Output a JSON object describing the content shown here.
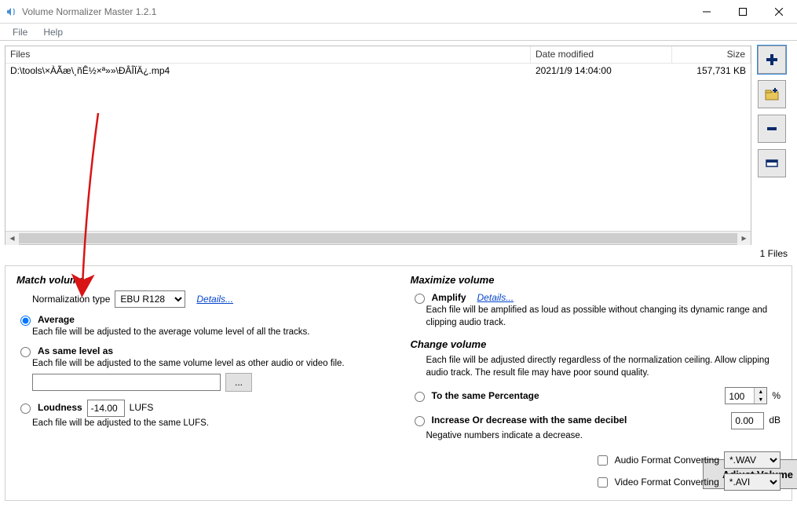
{
  "window": {
    "title": "Volume Normalizer Master 1.2.1"
  },
  "menu": {
    "file": "File",
    "help": "Help"
  },
  "table": {
    "headers": {
      "files": "Files",
      "date": "Date modified",
      "size": "Size"
    },
    "rows": [
      {
        "path": "D:\\tools\\×ÀÃæ\\¸ñÊ½×ª»»\\ÐÂÎÏÄ¿.mp4",
        "date": "2021/1/9 14:04:00",
        "size": "157,731 KB"
      }
    ],
    "status": "1 Files"
  },
  "sidebar": {
    "add": "＋",
    "add_folder": "folder",
    "remove": "—",
    "clear": "clear"
  },
  "match": {
    "heading": "Match volumes",
    "norm_label": "Normalization type",
    "norm_value": "EBU R128",
    "details": "Details...",
    "average_label": "Average",
    "average_desc": "Each file will be adjusted to the average volume level of all the tracks.",
    "same_label": "As same level as",
    "same_desc": "Each file will be adjusted to the same volume level as other audio or video file.",
    "same_path": "",
    "browse": "...",
    "loudness_label": "Loudness",
    "loudness_value": "-14.00",
    "lufs": "LUFS",
    "loudness_desc": "Each file will be adjusted to the same LUFS."
  },
  "max": {
    "heading": "Maximize volume",
    "amplify_label": "Amplify",
    "details": "Details...",
    "amplify_desc": "Each file will be amplified as loud as possible without changing its dynamic range and clipping audio track."
  },
  "change": {
    "heading": "Change volume",
    "desc": "Each file will be adjusted directly regardless of the normalization ceiling. Allow clipping audio track. The result file may have poor sound quality.",
    "pct_label": "To the same Percentage",
    "pct_value": "100",
    "pct_unit": "%",
    "db_label": "Increase Or decrease with the same decibel",
    "db_value": "0.00",
    "db_unit": "dB",
    "db_note": "Negative numbers indicate a decrease."
  },
  "bottom": {
    "adjust": "Adjust Volume",
    "audio_fmt_label": "Audio Format Converting",
    "audio_fmt_value": "*.WAV",
    "video_fmt_label": "Video Format Converting",
    "video_fmt_value": "*.AVI"
  }
}
